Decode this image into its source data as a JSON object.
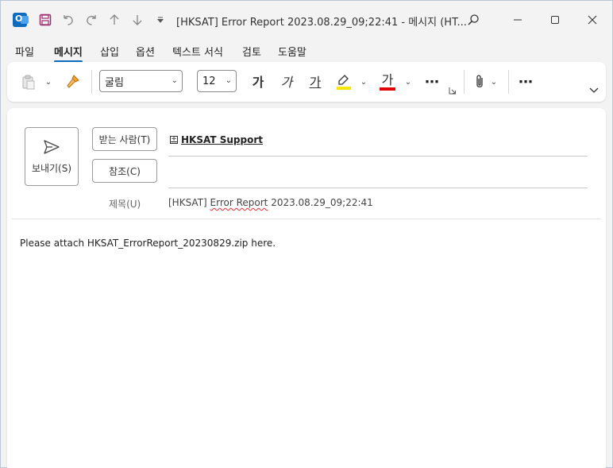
{
  "window": {
    "title": "[HKSAT] Error Report 2023.08.29_09;22:41  -  메시지 (HT...",
    "app_icon": "outlook-icon",
    "app_letter": "O"
  },
  "titlebar_buttons": [
    "save-icon",
    "undo-icon",
    "redo-icon",
    "up-icon",
    "down-icon",
    "customize-icon"
  ],
  "window_controls": [
    "search-icon",
    "minimize-icon",
    "maximize-icon",
    "close-icon"
  ],
  "menu": {
    "items": [
      "파일",
      "메시지",
      "삽입",
      "옵션",
      "텍스트 서식",
      "검토",
      "도움말"
    ],
    "active": "메시지"
  },
  "ribbon": {
    "font_name": "굴림",
    "font_size": "12",
    "bold_label": "가",
    "italic_label": "가",
    "underline_label": "가",
    "font_color_label": "가",
    "more_label": "⋯",
    "highlight_color": "#f5e600",
    "font_color": "#e00000"
  },
  "compose": {
    "send_label": "보내기(S)",
    "to_button": "받는 사람(T)",
    "cc_button": "참조(C)",
    "to_recipient": "HKSAT Support",
    "subject_label": "제목(U)",
    "subject_prefix": "[HKSAT] ",
    "subject_misspelled": "Error Report",
    "subject_suffix": " 2023.08.29_09;22:41",
    "body": "Please attach HKSAT_ErrorReport_20230829.zip here."
  },
  "colors": {
    "accent": "#0f6cbd"
  }
}
